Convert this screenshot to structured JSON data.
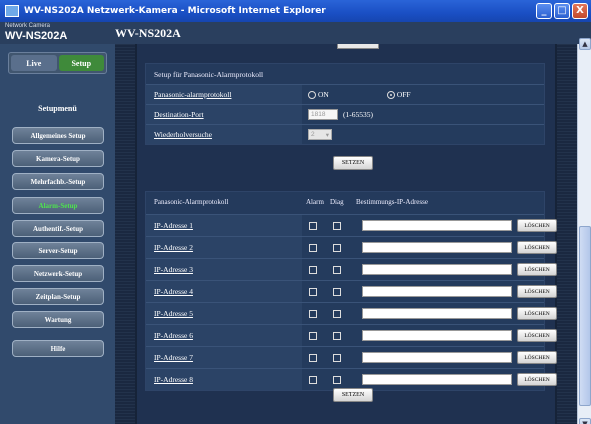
{
  "window": {
    "title": "WV-NS202A Netzwerk-Kamera - Microsoft Internet Explorer",
    "min": "_",
    "max": "□",
    "close": "X"
  },
  "header": {
    "brand_small": "Network Camera",
    "brand_big": "WV-NS202A",
    "page_title": "WV-NS202A"
  },
  "sidebar": {
    "live_label": "Live",
    "setup_label": "Setup",
    "menu_heading": "Setupmenü",
    "items": [
      {
        "label": "Allgemeines Setup"
      },
      {
        "label": "Kamera-Setup"
      },
      {
        "label": "Mehrfachb.-Setup"
      },
      {
        "label": "Alarm-Setup",
        "active": true
      },
      {
        "label": "Authentif.-Setup"
      },
      {
        "label": "Server-Setup"
      },
      {
        "label": "Netzwerk-Setup"
      },
      {
        "label": "Zeitplan-Setup"
      },
      {
        "label": "Wartung"
      }
    ],
    "help_label": "Hilfe"
  },
  "protocol_setup": {
    "heading": "Setup für Panasonic-Alarmprotokoll",
    "rows": {
      "alarm_protocol": {
        "label": "Panasonic-alarmprotokoll",
        "on_label": "ON",
        "off_label": "OFF",
        "selected": "OFF"
      },
      "destination_port": {
        "label": "Destination-Port",
        "value": "1818",
        "range": "(1-65535)"
      },
      "retries": {
        "label": "Wiederholversuche",
        "value": "2"
      }
    },
    "set_label": "SETZEN"
  },
  "ip_table": {
    "heading": "Panasonic-Alarmprotokoll",
    "col_alarm": "Alarm",
    "col_diag": "Diag",
    "col_ip": "Bestimmungs-IP-Adresse",
    "delete_label": "LÖSCHEN",
    "rows": [
      {
        "label": "IP-Adresse 1",
        "ip": "",
        "alarm": false,
        "diag": false
      },
      {
        "label": "IP-Adresse 2",
        "ip": "",
        "alarm": false,
        "diag": false
      },
      {
        "label": "IP-Adresse 3",
        "ip": "",
        "alarm": false,
        "diag": false
      },
      {
        "label": "IP-Adresse 4",
        "ip": "",
        "alarm": false,
        "diag": false
      },
      {
        "label": "IP-Adresse 5",
        "ip": "",
        "alarm": false,
        "diag": false
      },
      {
        "label": "IP-Adresse 6",
        "ip": "",
        "alarm": false,
        "diag": false
      },
      {
        "label": "IP-Adresse 7",
        "ip": "",
        "alarm": false,
        "diag": false
      },
      {
        "label": "IP-Adresse 8",
        "ip": "",
        "alarm": false,
        "diag": false
      }
    ],
    "set_label": "SETZEN"
  },
  "scrollbar": {
    "up_icon": "▲",
    "down_icon": "▼"
  }
}
